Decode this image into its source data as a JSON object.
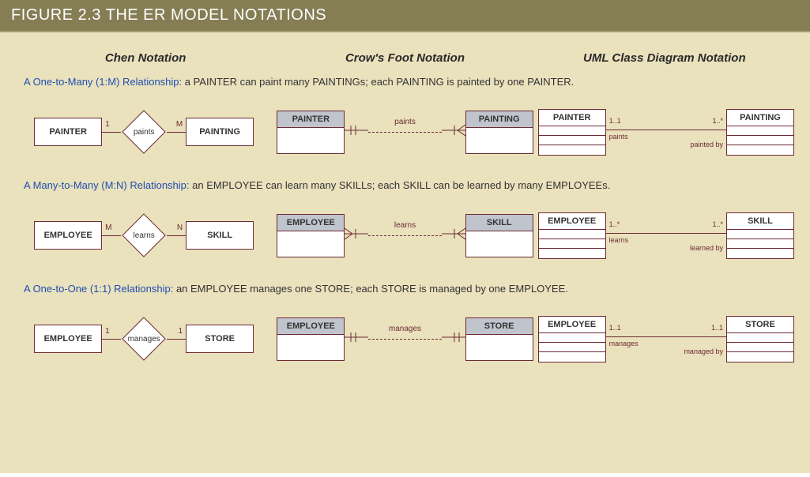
{
  "header": "FIGURE 2.3  THE ER MODEL NOTATIONS",
  "columns": {
    "chen": "Chen Notation",
    "crow": "Crow's Foot Notation",
    "uml": "UML Class Diagram Notation"
  },
  "rows": [
    {
      "lead": "A One-to-Many (1:M) Relationship:",
      "desc": " a PAINTER can paint many PAINTINGs; each PAINTING is painted by one PAINTER.",
      "chen": {
        "left": "PAINTER",
        "rel": "paints",
        "right": "PAINTING",
        "cardL": "1",
        "cardR": "M"
      },
      "crow": {
        "left": "PAINTER",
        "rel": "paints",
        "right": "PAINTING",
        "endL": "one-mand",
        "endR": "many-mand"
      },
      "uml": {
        "left": "PAINTER",
        "right": "PAINTING",
        "multL": "1..1",
        "multR": "1..*",
        "labL": "paints",
        "labR": "painted by"
      }
    },
    {
      "lead": "A Many-to-Many (M:N) Relationship:",
      "desc": " an EMPLOYEE can learn many SKILLs; each SKILL can be learned by many EMPLOYEEs.",
      "chen": {
        "left": "EMPLOYEE",
        "rel": "learns",
        "right": "SKILL",
        "cardL": "M",
        "cardR": "N"
      },
      "crow": {
        "left": "EMPLOYEE",
        "rel": "learns",
        "right": "SKILL",
        "endL": "many-mand",
        "endR": "many-mand"
      },
      "uml": {
        "left": "EMPLOYEE",
        "right": "SKILL",
        "multL": "1..*",
        "multR": "1..*",
        "labL": "learns",
        "labR": "learned by"
      }
    },
    {
      "lead": "A One-to-One (1:1) Relationship:",
      "desc": " an EMPLOYEE manages one STORE; each STORE is managed by one EMPLOYEE.",
      "chen": {
        "left": "EMPLOYEE",
        "rel": "manages",
        "right": "STORE",
        "cardL": "1",
        "cardR": "1"
      },
      "crow": {
        "left": "EMPLOYEE",
        "rel": "manages",
        "right": "STORE",
        "endL": "one-mand",
        "endR": "one-mand"
      },
      "uml": {
        "left": "EMPLOYEE",
        "right": "STORE",
        "multL": "1..1",
        "multR": "1..1",
        "labL": "manages",
        "labR": "managed by"
      }
    }
  ],
  "colors": {
    "stroke": "#6b2b34",
    "headerBg": "#857e54",
    "bodyBg": "#eae1bd",
    "cfHead": "#c0c4cd",
    "descLead": "#1f4fb0"
  }
}
